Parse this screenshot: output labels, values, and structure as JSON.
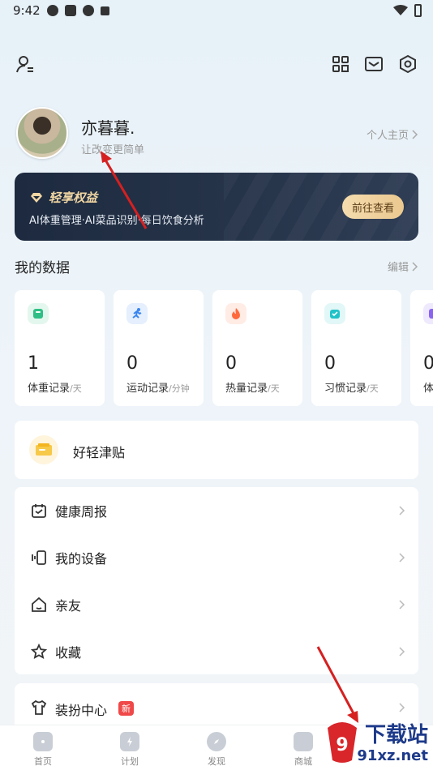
{
  "status_bar": {
    "time": "9:42"
  },
  "profile": {
    "username": "亦暮暮.",
    "signature": "让改变更简单",
    "homepage_link": "个人主页"
  },
  "vip": {
    "title": "轻享权益",
    "description": "AI体重管理·AI菜品识别·每日饮食分析",
    "button": "前往查看",
    "accent_color": "#f1d6a3"
  },
  "my_data": {
    "title": "我的数据",
    "edit_label": "编辑",
    "cards": [
      {
        "value": "1",
        "label": "体重记录",
        "unit": "/天",
        "icon": "scale-icon",
        "color": "#2fbf86",
        "bg": "#e4f7ee"
      },
      {
        "value": "0",
        "label": "运动记录",
        "unit": "/分钟",
        "icon": "running-icon",
        "color": "#3a86f0",
        "bg": "#e5effd"
      },
      {
        "value": "0",
        "label": "热量记录",
        "unit": "/天",
        "icon": "flame-icon",
        "color": "#ff6a3d",
        "bg": "#ffece5"
      },
      {
        "value": "0",
        "label": "习惯记录",
        "unit": "/天",
        "icon": "habit-icon",
        "color": "#22c3c8",
        "bg": "#e2f7f7"
      },
      {
        "value": "0",
        "label": "体",
        "unit": "",
        "icon": "extra-icon",
        "color": "#8a63f0",
        "bg": "#efe9fd"
      }
    ]
  },
  "subsidy": {
    "label": "好轻津贴"
  },
  "menu": [
    {
      "label": "健康周报",
      "icon": "calendar-icon"
    },
    {
      "label": "我的设备",
      "icon": "device-icon"
    },
    {
      "label": "亲友",
      "icon": "home-icon"
    },
    {
      "label": "收藏",
      "icon": "star-icon"
    }
  ],
  "dress": {
    "label": "装扮中心",
    "badge": "新"
  },
  "bottom_nav": [
    {
      "label": "首页"
    },
    {
      "label": "计划"
    },
    {
      "label": "发现"
    },
    {
      "label": "商城"
    }
  ],
  "watermark": {
    "big": "下载站",
    "small": "91xz.net"
  }
}
